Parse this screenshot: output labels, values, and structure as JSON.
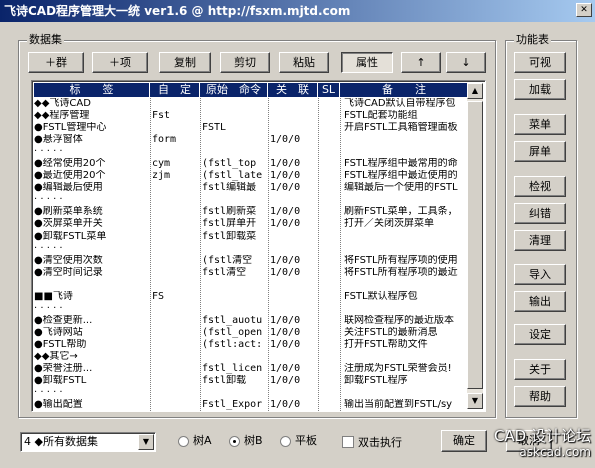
{
  "window": {
    "title": "飞诗CAD程序管理大一统 ver1.6 @ http://fsxm.mjtd.com"
  },
  "groups": {
    "data": "数据集",
    "func": "功能表"
  },
  "toolbar": [
    "＋群",
    "＋项",
    "复制",
    "剪切",
    "粘贴",
    "属性",
    "↑",
    "↓"
  ],
  "side_buttons": [
    "可视",
    "加载",
    "菜单",
    "屏单",
    "检视",
    "纠错",
    "清理",
    "导入",
    "输出",
    "设定",
    "关于",
    "帮助"
  ],
  "columns": [
    "标　　签",
    "自　定",
    "原始　命令",
    "关　联",
    "SL",
    "备　　注"
  ],
  "rows": [
    {
      "c0": "◆◆飞诗CAD",
      "c1": "",
      "c2": "",
      "c3": "",
      "c4": "飞诗CAD默认自带程序包"
    },
    {
      "c0": "◆◆程序管理",
      "c1": "Fst",
      "c2": "",
      "c3": "",
      "c4": "FSTL配套功能组"
    },
    {
      "c0": "●FSTL管理中心",
      "c1": "",
      "c2": "FSTL",
      "c3": "",
      "c4": "开启FSTL工具箱管理面板"
    },
    {
      "c0": "●悬浮窗体",
      "c1": "form",
      "c2": "",
      "c3": "1/0/0",
      "c4": ""
    },
    {
      "c0": "· · · · ·",
      "c1": "",
      "c2": "",
      "c3": "",
      "c4": ""
    },
    {
      "c0": "●经常使用20个",
      "c1": "cym",
      "c2": "(fstl_top",
      "c3": "1/0/0",
      "c4": "FSTL程序组中最常用的命"
    },
    {
      "c0": "●最近使用20个",
      "c1": "zjm",
      "c2": "(fstl_late",
      "c3": "1/0/0",
      "c4": "FSTL程序组中最近使用的"
    },
    {
      "c0": "●编辑最后使用",
      "c1": "",
      "c2": "fstl编辑最",
      "c3": "1/0/0",
      "c4": "编辑最后一个使用的FSTL"
    },
    {
      "c0": "· · · · ·",
      "c1": "",
      "c2": "",
      "c3": "",
      "c4": ""
    },
    {
      "c0": "●刷新菜单系统",
      "c1": "",
      "c2": "fstl刷新菜",
      "c3": "1/0/0",
      "c4": "刷新FSTL菜单，工具条，"
    },
    {
      "c0": "●茨屏菜单开关",
      "c1": "",
      "c2": "fstl屏单开",
      "c3": "1/0/0",
      "c4": "打开／关闭茨屏菜单"
    },
    {
      "c0": "●卸载FSTL菜单",
      "c1": "",
      "c2": "fstl卸载菜",
      "c3": "",
      "c4": ""
    },
    {
      "c0": "· · · · ·",
      "c1": "",
      "c2": "",
      "c3": "",
      "c4": ""
    },
    {
      "c0": "●清空使用次数",
      "c1": "",
      "c2": "(fstl清空",
      "c3": "1/0/0",
      "c4": "将FSTL所有程序项的使用"
    },
    {
      "c0": "●清空时间记录",
      "c1": "",
      "c2": "fstl清空",
      "c3": "1/0/0",
      "c4": "将FSTL所有程序项的最近"
    },
    {
      "c0": "",
      "c1": "",
      "c2": "",
      "c3": "",
      "c4": ""
    },
    {
      "c0": "■■飞诗",
      "c1": "FS",
      "c2": "",
      "c3": "",
      "c4": "FSTL默认程序包"
    },
    {
      "c0": "· · · · ·",
      "c1": "",
      "c2": "",
      "c3": "",
      "c4": ""
    },
    {
      "c0": "●检查更新...",
      "c1": "",
      "c2": "fstl_auotu",
      "c3": "1/0/0",
      "c4": "联网检查程序的最近版本"
    },
    {
      "c0": "●飞诗网站",
      "c1": "",
      "c2": "(fstl_open",
      "c3": "1/0/0",
      "c4": "关注FSTL的最新消息"
    },
    {
      "c0": "●FSTL帮助",
      "c1": "",
      "c2": "(fstl:act:",
      "c3": "1/0/0",
      "c4": "打开FSTL帮助文件"
    },
    {
      "c0": "◆◆其它→",
      "c1": "",
      "c2": "",
      "c3": "",
      "c4": ""
    },
    {
      "c0": "●荣誉注册...",
      "c1": "",
      "c2": "fstl_licen",
      "c3": "1/0/0",
      "c4": "注册成为FSTL荣誉会员!"
    },
    {
      "c0": "●卸载FSTL",
      "c1": "",
      "c2": "fstl卸载",
      "c3": "1/0/0",
      "c4": "卸载FSTL程序"
    },
    {
      "c0": "· · · · ·",
      "c1": "",
      "c2": "",
      "c3": "",
      "c4": ""
    },
    {
      "c0": "●输出配置",
      "c1": "",
      "c2": "Fstl_Expor",
      "c3": "1/0/0",
      "c4": "输出当前配置到FSTL/sy"
    }
  ],
  "bottom": {
    "combo": "4 ◆所有数据集",
    "radios": [
      {
        "label": "树A",
        "checked": false
      },
      {
        "label": "树B",
        "checked": true
      },
      {
        "label": "平板",
        "checked": false
      }
    ],
    "check": "双击执行",
    "ok": "确定",
    "cancel": "取消"
  },
  "watermark": {
    "line1": "CAD 设计论坛",
    "line2": "askcad.com"
  }
}
